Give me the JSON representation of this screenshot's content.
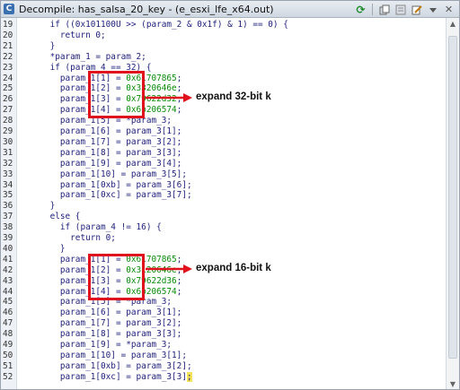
{
  "window": {
    "title": "Decompile: has_salsa_20_key - (e_esxi_lfe_x64.out)",
    "app_icon": "C",
    "toolbar_icons": [
      "refresh-icon",
      "copy-icon",
      "snapshot-icon",
      "edit-icon",
      "menu-icon",
      "close-icon"
    ],
    "close_glyph": "✕",
    "refresh_glyph": "⟳"
  },
  "lines": [
    {
      "n": "19",
      "parts": [
        {
          "t": "    if ((0x101100U >> (param_2 & 0x1f) & 1) == 0) {"
        }
      ]
    },
    {
      "n": "20",
      "parts": [
        {
          "t": "      return 0;"
        }
      ]
    },
    {
      "n": "21",
      "parts": [
        {
          "t": "    }"
        }
      ]
    },
    {
      "n": "22",
      "parts": [
        {
          "t": "    *param_1 = param_2;"
        }
      ]
    },
    {
      "n": "23",
      "parts": [
        {
          "t": "    if (param_4 == 32) {"
        }
      ]
    },
    {
      "n": "24",
      "parts": [
        {
          "t": "      param_1[1] = "
        },
        {
          "t": "0x61707865",
          "c": "hex"
        },
        {
          "t": ";"
        }
      ]
    },
    {
      "n": "25",
      "parts": [
        {
          "t": "      param_1[2] = "
        },
        {
          "t": "0x3320646e",
          "c": "hex"
        },
        {
          "t": ";"
        }
      ]
    },
    {
      "n": "26",
      "parts": [
        {
          "t": "      param_1[3] = "
        },
        {
          "t": "0x79622d32",
          "c": "hex"
        },
        {
          "t": ";"
        }
      ]
    },
    {
      "n": "27",
      "parts": [
        {
          "t": "      param_1[4] = "
        },
        {
          "t": "0x6b206574",
          "c": "hex"
        },
        {
          "t": ";"
        }
      ]
    },
    {
      "n": "28",
      "parts": [
        {
          "t": "      param_1[5] = *param_3;"
        }
      ]
    },
    {
      "n": "29",
      "parts": [
        {
          "t": "      param_1[6] = param_3[1];"
        }
      ]
    },
    {
      "n": "30",
      "parts": [
        {
          "t": "      param_1[7] = param_3[2];"
        }
      ]
    },
    {
      "n": "31",
      "parts": [
        {
          "t": "      param_1[8] = param_3[3];"
        }
      ]
    },
    {
      "n": "32",
      "parts": [
        {
          "t": "      param_1[9] = param_3[4];"
        }
      ]
    },
    {
      "n": "33",
      "parts": [
        {
          "t": "      param_1[10] = param_3[5];"
        }
      ]
    },
    {
      "n": "34",
      "parts": [
        {
          "t": "      param_1[0xb] = param_3[6];"
        }
      ]
    },
    {
      "n": "35",
      "parts": [
        {
          "t": "      param_1[0xc] = param_3[7];"
        }
      ]
    },
    {
      "n": "36",
      "parts": [
        {
          "t": "    }"
        }
      ]
    },
    {
      "n": "37",
      "parts": [
        {
          "t": "    else {"
        }
      ]
    },
    {
      "n": "38",
      "parts": [
        {
          "t": "      if (param_4 != 16) {"
        }
      ]
    },
    {
      "n": "39",
      "parts": [
        {
          "t": "        return 0;"
        }
      ]
    },
    {
      "n": "40",
      "parts": [
        {
          "t": "      }"
        }
      ]
    },
    {
      "n": "41",
      "parts": [
        {
          "t": "      param_1[1] = "
        },
        {
          "t": "0x61707865",
          "c": "hex"
        },
        {
          "t": ";"
        }
      ]
    },
    {
      "n": "42",
      "parts": [
        {
          "t": "      param_1[2] = "
        },
        {
          "t": "0x3120646e",
          "c": "hex"
        },
        {
          "t": ";"
        }
      ]
    },
    {
      "n": "43",
      "parts": [
        {
          "t": "      param_1[3] = "
        },
        {
          "t": "0x79622d36",
          "c": "hex"
        },
        {
          "t": ";"
        }
      ]
    },
    {
      "n": "44",
      "parts": [
        {
          "t": "      param_1[4] = "
        },
        {
          "t": "0x6b206574",
          "c": "hex"
        },
        {
          "t": ";"
        }
      ]
    },
    {
      "n": "45",
      "parts": [
        {
          "t": "      param_1[5] = *param_3;"
        }
      ]
    },
    {
      "n": "46",
      "parts": [
        {
          "t": "      param_1[6] = param_3[1];"
        }
      ]
    },
    {
      "n": "47",
      "parts": [
        {
          "t": "      param_1[7] = param_3[2];"
        }
      ]
    },
    {
      "n": "48",
      "parts": [
        {
          "t": "      param_1[8] = param_3[3];"
        }
      ]
    },
    {
      "n": "49",
      "parts": [
        {
          "t": "      param_1[9] = *param_3;"
        }
      ]
    },
    {
      "n": "50",
      "parts": [
        {
          "t": "      param_1[10] = param_3[1];"
        }
      ]
    },
    {
      "n": "51",
      "parts": [
        {
          "t": "      param_1[0xb] = param_3[2];"
        }
      ]
    },
    {
      "n": "52",
      "parts": [
        {
          "t": "      param_1[0xc] = param_3[3]"
        },
        {
          "t": ";",
          "c": "cursor"
        }
      ]
    }
  ],
  "annotations": {
    "expand32": "expand 32-bit k",
    "expand16": "expand 16-bit k"
  },
  "colors": {
    "highlight": "#e0121e",
    "hex": "#0a8a0a",
    "code": "#1e1e7a"
  }
}
